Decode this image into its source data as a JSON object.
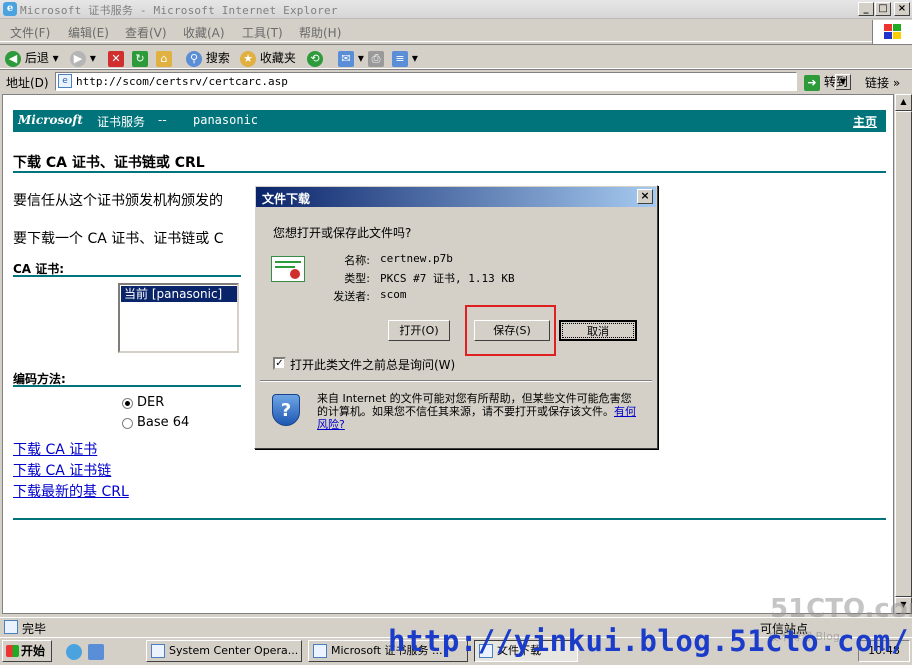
{
  "window": {
    "title": "Microsoft 证书服务 - Microsoft Internet Explorer",
    "controls": {
      "minimize": "_",
      "maximize": "□",
      "close": "×"
    }
  },
  "menu": [
    "文件(F)",
    "编辑(E)",
    "查看(V)",
    "收藏(A)",
    "工具(T)",
    "帮助(H)"
  ],
  "toolbar": {
    "back": "后退",
    "search": "搜索",
    "favorites": "收藏夹"
  },
  "address": {
    "label": "地址(D)",
    "url": "http://scom/certsrv/certcarc.asp",
    "go": "转到",
    "links": "链接"
  },
  "page": {
    "banner": {
      "ms": "Microsoft",
      "service": "证书服务",
      "dash": "--",
      "server": "panasonic",
      "home": "主页"
    },
    "heading": "下载 CA 证书、证书链或 CRL",
    "para1": "要信任从这个证书颁发机构颁发的",
    "para2": "要下载一个 CA 证书、证书链或 C",
    "ca_label": "CA 证书:",
    "ca_selected": "当前 [panasonic]",
    "encoding_label": "编码方法:",
    "encoding_options": [
      "DER",
      "Base 64"
    ],
    "links": [
      "下载 CA 证书",
      "下载 CA 证书链",
      "下载最新的基 CRL"
    ]
  },
  "dialog": {
    "title": "文件下载",
    "close": "×",
    "question": "您想打开或保存此文件吗?",
    "name_label": "名称:",
    "name": "certnew.p7b",
    "type_label": "类型:",
    "type": "PKCS #7 证书, 1.13 KB",
    "from_label": "发送者:",
    "from": "scom",
    "buttons": {
      "open": "打开(O)",
      "save": "保存(S)",
      "cancel": "取消"
    },
    "checkbox_label": "打开此类文件之前总是询问(W)",
    "checkbox_checked": true,
    "warning": "来自 Internet 的文件可能对您有所帮助，但某些文件可能危害您的计算机。如果您不信任其来源，请不要打开或保存该文件。",
    "risk_link": "有何风险?"
  },
  "status": {
    "text": "完毕",
    "zone": "可信站点"
  },
  "taskbar": {
    "start": "开始",
    "tasks": [
      "System Center Opera...",
      "Microsoft 证书服务 ...",
      "文件下载"
    ],
    "clock": "10:48"
  },
  "watermark": {
    "url": "http://yinkui.blog.51cto.com/",
    "brand": "51CTO.com",
    "sub": "技术博客 Blog"
  },
  "colors": {
    "accent": "#00747a",
    "highlight": "#e02020",
    "selection": "#0a246a"
  }
}
